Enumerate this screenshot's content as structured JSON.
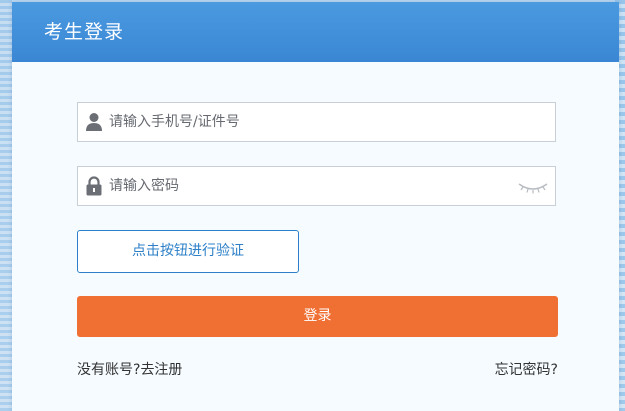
{
  "dialog": {
    "title": "考生登录"
  },
  "username": {
    "placeholder": "请输入手机号/证件号",
    "value": "",
    "icon": "user-icon"
  },
  "password": {
    "placeholder": "请输入密码",
    "value": "",
    "icon": "lock-icon",
    "toggle_icon": "eye-closed-icon"
  },
  "verify": {
    "label": "点击按钮进行验证"
  },
  "login": {
    "label": "登录"
  },
  "footer": {
    "no_account_text": "没有账号?",
    "register_label": "去注册",
    "forgot_label": "忘记密码?"
  },
  "colors": {
    "header": "#3a86d4",
    "accent": "#2c7fc8",
    "login_button": "#f07034",
    "dialog_background": "#f5fbff"
  }
}
